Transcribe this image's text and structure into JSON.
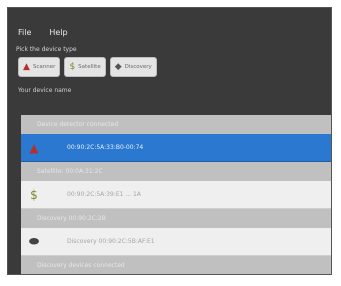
{
  "menu": {
    "file": "File",
    "help": "Help"
  },
  "hint": "Pick the device type",
  "toolbar": {
    "buttons": [
      {
        "label": "Scanner",
        "icon": "person-icon",
        "icon_char": "▲"
      },
      {
        "label": "Satellite",
        "icon": "dollar-icon",
        "icon_char": "$"
      },
      {
        "label": "Discovery",
        "icon": "mouse-icon",
        "icon_char": "◆"
      }
    ]
  },
  "status": "Your device name",
  "groups": [
    {
      "header": "Device detector connected",
      "item": {
        "label": "00:90:2C:5A:33:B0-00:74",
        "icon_char": "▲",
        "icon_color": "#b0332b",
        "selected": true
      }
    },
    {
      "header": "Satellite: 00:0A:31:2C",
      "item": {
        "label": "00:90:2C:5A:39:E1 ... 1A",
        "icon_char": "$",
        "icon_color": "#7a8a2a",
        "selected": false
      }
    },
    {
      "header": "Discovery 00:90:2C:2B",
      "item": {
        "label": "Discovery 00:90:2C:5B:AF:E1",
        "icon_char": "⬬",
        "icon_color": "#444444",
        "selected": false
      }
    },
    {
      "header": "Discovery devices connected",
      "item": null
    }
  ]
}
